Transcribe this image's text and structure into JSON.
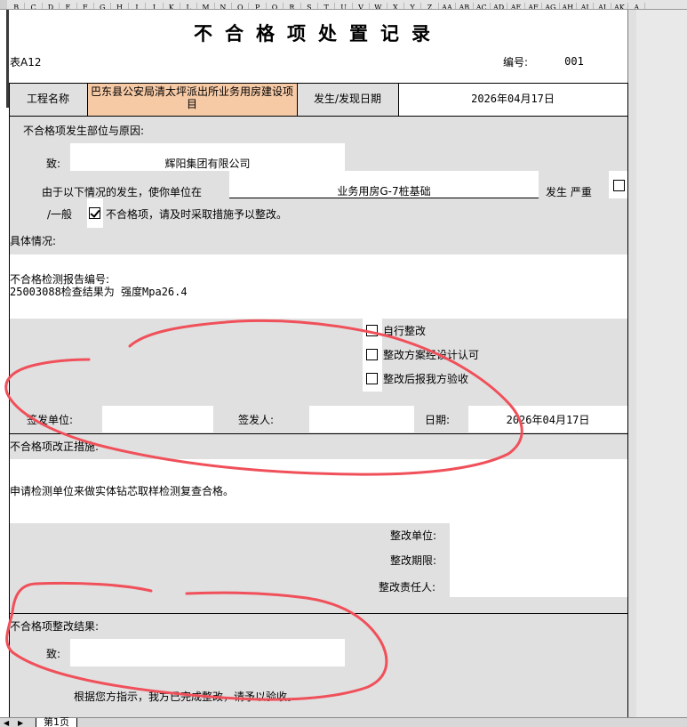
{
  "column_headers": [
    "B",
    "C",
    "D",
    "E",
    "F",
    "G",
    "H",
    "I",
    "J",
    "K",
    "L",
    "M",
    "N",
    "O",
    "P",
    "Q",
    "R",
    "S",
    "T",
    "U",
    "V",
    "W",
    "X",
    "Y",
    "Z",
    "AA",
    "AB",
    "AC",
    "AD",
    "AE",
    "AF",
    "AG",
    "AH",
    "AI",
    "AJ",
    "AK",
    "A"
  ],
  "form": {
    "title": "不合格项处置记录",
    "table_no": "表A12",
    "serial_label": "编号:",
    "serial_value": "001",
    "project_label": "工程名称",
    "project_value": "巴东县公安局清太坪派出所业务用房建设项目",
    "date_label": "发生/发现日期",
    "date_value": "2026年04月17日"
  },
  "section1": {
    "heading": "不合格项发生部位与原因:",
    "to_label": "致:",
    "to_value": "辉阳集团有限公司",
    "sentence_prefix": "由于以下情况的发生，使你单位在",
    "location_value": "业务用房G-7桩基础",
    "sentence_suffix": "发生  严重",
    "severity_general": "/一般",
    "sentence_end": "不合格项，请及时采取措施予以整改。",
    "severe_checked": false,
    "general_checked": true
  },
  "details": {
    "heading": "具体情况:",
    "line1": "不合格检测报告编号:",
    "line2": "25003088检查结果为 强度Mpa26.4"
  },
  "options": [
    {
      "label": "自行整改",
      "checked": false
    },
    {
      "label": "整改方案经设计认可",
      "checked": false
    },
    {
      "label": "整改后报我方验收",
      "checked": false
    }
  ],
  "signoff": {
    "unit_label": "签发单位:",
    "unit_value": "",
    "person_label": "签发人:",
    "person_value": "",
    "date_label": "日期:",
    "date_value": "2026年04月17日"
  },
  "correction": {
    "heading": "不合格项改正措施:",
    "text": "申请检测单位来做实体钻芯取样检测复查合格。",
    "unit_label": "整改单位:",
    "deadline_label": "整改期限:",
    "responsible_label": "整改责任人:"
  },
  "result": {
    "heading": "不合格项整改结果:",
    "to_label": "致:",
    "to_value": "",
    "text": "根据您方指示，我方已完成整改，请予以验收。"
  },
  "tabs": {
    "sheet1": "第1页"
  },
  "colors": {
    "grey_cell": "#e0e0e0",
    "peach_cell": "#f7caa6",
    "annotation": "#f0505a"
  }
}
